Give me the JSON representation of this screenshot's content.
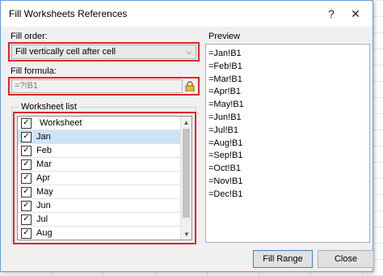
{
  "window": {
    "title": "Fill Worksheets References",
    "help_label": "?",
    "close_label": "✕"
  },
  "fill_order": {
    "label": "Fill order:",
    "selected": "Fill vertically cell after cell"
  },
  "fill_formula": {
    "label": "Fill formula:",
    "value": "=?!B1"
  },
  "worksheet_list": {
    "group_label": "Worksheet list",
    "header": "Worksheet",
    "items": [
      {
        "name": "Jan",
        "checked": true
      },
      {
        "name": "Feb",
        "checked": true
      },
      {
        "name": "Mar",
        "checked": true
      },
      {
        "name": "Apr",
        "checked": true
      },
      {
        "name": "May",
        "checked": true
      },
      {
        "name": "Jun",
        "checked": true
      },
      {
        "name": "Jul",
        "checked": true
      },
      {
        "name": "Aug",
        "checked": true
      }
    ]
  },
  "preview": {
    "label": "Preview",
    "lines": [
      "=Jan!B1",
      "=Feb!B1",
      "=Mar!B1",
      "=Apr!B1",
      "=May!B1",
      "=Jun!B1",
      "=Jul!B1",
      "=Aug!B1",
      "=Sep!B1",
      "=Oct!B1",
      "=Nov!B1",
      "=Dec!B1"
    ]
  },
  "buttons": {
    "fill_range": "Fill Range",
    "close": "Close"
  },
  "colors": {
    "highlight": "#e0262b",
    "selection": "#cce3f7"
  }
}
